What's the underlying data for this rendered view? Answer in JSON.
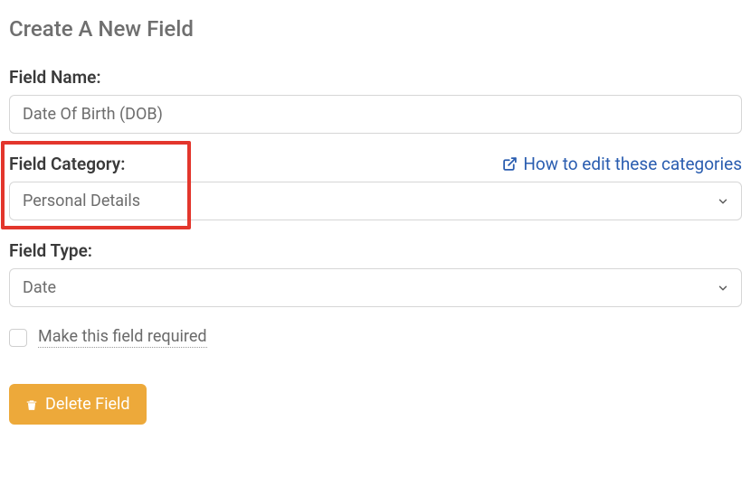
{
  "page": {
    "title": "Create A New Field"
  },
  "fields": {
    "name": {
      "label": "Field Name:",
      "value": "Date Of Birth (DOB)"
    },
    "category": {
      "label": "Field Category:",
      "selected": "Personal Details",
      "help_link": "How to edit these categories"
    },
    "type": {
      "label": "Field Type:",
      "selected": "Date"
    },
    "required": {
      "label": "Make this field required",
      "checked": false
    }
  },
  "actions": {
    "delete_label": "Delete Field"
  }
}
